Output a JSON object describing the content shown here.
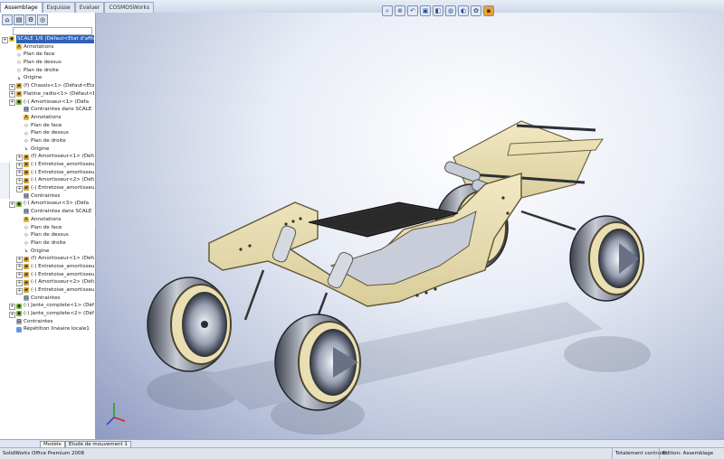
{
  "command_tabs": [
    "Assemblage",
    "Esquisse",
    "Evaluer",
    "COSMOSWorks"
  ],
  "view_toolbar_icons": [
    "zoom-fit-icon",
    "zoom-area-icon",
    "previous-view-icon",
    "section-view-icon",
    "view-orientation-icon",
    "display-style-icon",
    "hide-show-icon",
    "appearance-icon",
    "scene-icon"
  ],
  "panel_tabs_icons": [
    "feature-manager-icon",
    "property-manager-icon",
    "configuration-manager-icon",
    "dim-expert-icon"
  ],
  "filter_placeholder": "",
  "tree": [
    {
      "label": "SCALE 1/6  (Défaut<Etat d'affich",
      "level": 0,
      "icon": "assembly-icon",
      "selected": true
    },
    {
      "label": "Annotations",
      "level": 1,
      "icon": "annotation-icon"
    },
    {
      "label": "Plan de face",
      "level": 1,
      "icon": "plane-icon"
    },
    {
      "label": "Plan de dessus",
      "level": 1,
      "icon": "plane-icon"
    },
    {
      "label": "Plan de droite",
      "level": 1,
      "icon": "plane-icon"
    },
    {
      "label": "Origine",
      "level": 1,
      "icon": "origin-icon"
    },
    {
      "label": "(f) Chassis<1> (Défaut<Etat",
      "level": 1,
      "icon": "part-icon"
    },
    {
      "label": "Platine_radio<1> (Défaut<Eta",
      "level": 1,
      "icon": "part-icon"
    },
    {
      "label": "(-) Amortisseur<1> (Défa",
      "level": 1,
      "icon": "subassembly-icon"
    },
    {
      "label": "Contraintes dans SCALE 1",
      "level": 2,
      "icon": "mates-icon"
    },
    {
      "label": "Annotations",
      "level": 2,
      "icon": "annotation-icon"
    },
    {
      "label": "Plan de face",
      "level": 2,
      "icon": "plane-icon"
    },
    {
      "label": "Plan de dessus",
      "level": 2,
      "icon": "plane-icon"
    },
    {
      "label": "Plan de droite",
      "level": 2,
      "icon": "plane-icon"
    },
    {
      "label": "Origine",
      "level": 2,
      "icon": "origin-icon"
    },
    {
      "label": "(f) Amortisseur<1> (Défa",
      "level": 2,
      "icon": "part-icon"
    },
    {
      "label": "(-) Entretoise_amortisseur",
      "level": 2,
      "icon": "part-icon"
    },
    {
      "label": "(-) Entretoise_amortisseur",
      "level": 2,
      "icon": "part-icon"
    },
    {
      "label": "(-) Amortisseur<2> (Défa",
      "level": 2,
      "icon": "part-icon"
    },
    {
      "label": "(-) Entretoise_amortisseur",
      "level": 2,
      "icon": "part-icon"
    },
    {
      "label": "Contraintes",
      "level": 2,
      "icon": "mates-icon"
    },
    {
      "label": "(-) Amortisseur<3> (Défa",
      "level": 1,
      "icon": "subassembly-icon"
    },
    {
      "label": "Contraintes dans SCALE 1",
      "level": 2,
      "icon": "mates-icon"
    },
    {
      "label": "Annotations",
      "level": 2,
      "icon": "annotation-icon"
    },
    {
      "label": "Plan de face",
      "level": 2,
      "icon": "plane-icon"
    },
    {
      "label": "Plan de dessus",
      "level": 2,
      "icon": "plane-icon"
    },
    {
      "label": "Plan de droite",
      "level": 2,
      "icon": "plane-icon"
    },
    {
      "label": "Origine",
      "level": 2,
      "icon": "origin-icon"
    },
    {
      "label": "(f) Amortisseur<1> (Défa",
      "level": 2,
      "icon": "part-icon"
    },
    {
      "label": "(-) Entretoise_amortisseur",
      "level": 2,
      "icon": "part-icon"
    },
    {
      "label": "(-) Entretoise_amortisseur",
      "level": 2,
      "icon": "part-icon"
    },
    {
      "label": "(-) Amortisseur<2> (Défa",
      "level": 2,
      "icon": "part-icon"
    },
    {
      "label": "(-) Entretoise_amortisseur",
      "level": 2,
      "icon": "part-icon"
    },
    {
      "label": "Contraintes",
      "level": 2,
      "icon": "mates-icon"
    },
    {
      "label": "(-) Jante_complete<1> (Défa",
      "level": 1,
      "icon": "subassembly-icon"
    },
    {
      "label": "(-) Jante_complete<2> (Défa",
      "level": 1,
      "icon": "subassembly-icon"
    },
    {
      "label": "Contraintes",
      "level": 1,
      "icon": "mates-icon"
    },
    {
      "label": "Répétition linéaire locale1",
      "level": 1,
      "icon": "pattern-icon"
    }
  ],
  "model_tabs": [
    "Modèle",
    "Etude de mouvement 1"
  ],
  "status": {
    "app": "SolidWorks Office Premium 2008",
    "state": "Totalement contraint",
    "mode": "Edition: Assemblage"
  },
  "colors": {
    "chassis_plate": "#e9dfb2",
    "chassis_edge": "#6b6242",
    "radio_plate": "#2a2a2a",
    "wheel_metal": "#8a93a6",
    "selection": "#2e62b8"
  }
}
